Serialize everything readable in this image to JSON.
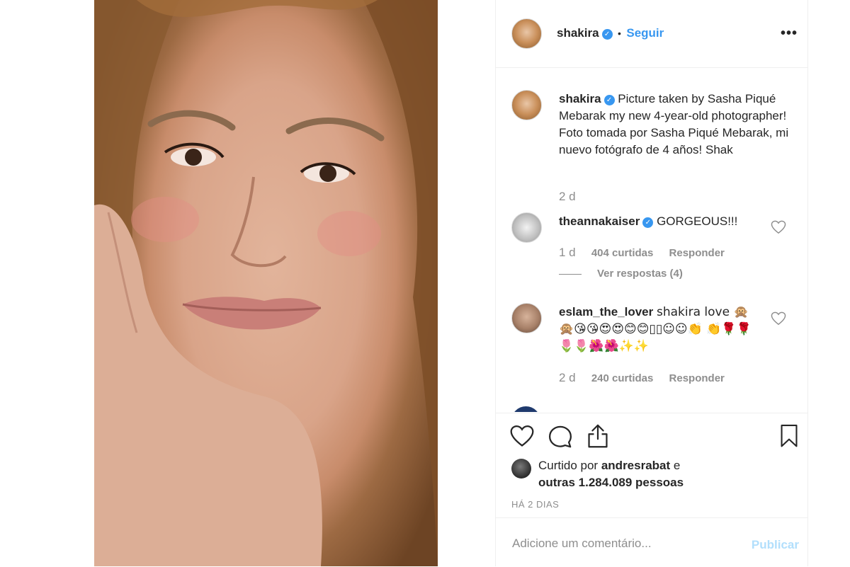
{
  "post": {
    "author": "shakira",
    "follow_label": "Seguir",
    "separator": "•",
    "more_icon": "more-horizontal-icon",
    "verified_icon": "verified-badge-icon"
  },
  "caption": {
    "username": "shakira",
    "text": "Picture taken by Sasha Piqué Mebarak my new 4-year-old photographer! Foto tomada por Sasha Piqué Mebarak, mi nuevo fotógrafo de 4 años! Shak",
    "time": "2 d"
  },
  "comments": [
    {
      "username": "theannakaiser",
      "text": "GORGEOUS!!!",
      "time": "1 d",
      "likes": "404 curtidas",
      "reply_label": "Responder",
      "view_replies": "Ver respostas (4)"
    },
    {
      "username": "eslam_the_lover",
      "text": "shakira love 🙊 🙊😘😘😍😍😊😊▯▯☺☺👏 👏🌹🌹🌷🌷🌺🌺✨✨",
      "time": "2 d",
      "likes": "240 curtidas",
      "reply_label": "Responder"
    }
  ],
  "likes": {
    "prefix": "Curtido por",
    "user": "andresrabat",
    "and": "e",
    "others": "outras 1.284.089 pessoas"
  },
  "date": "HÁ 2 DIAS",
  "add_comment": {
    "placeholder": "Adicione um comentário...",
    "publish_label": "Publicar"
  },
  "colors": {
    "accent": "#3897f0",
    "publish_disabled": "#b2dffc",
    "secondary_text": "#8e8e8e"
  }
}
